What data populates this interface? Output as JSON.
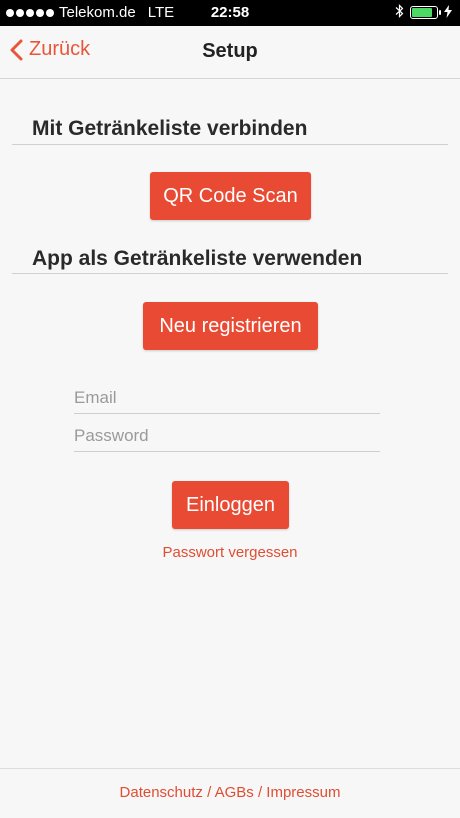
{
  "status_bar": {
    "carrier": "Telekom.de",
    "network": "LTE",
    "time": "22:58",
    "signal_bars": 5,
    "battery_level": 0.85
  },
  "navbar": {
    "back_label": "Zurück",
    "title": "Setup"
  },
  "sections": {
    "connect": {
      "title": "Mit Getränkeliste verbinden",
      "button_label": "QR Code Scan"
    },
    "use_app": {
      "title": "App als Getränkeliste verwenden",
      "register_label": "Neu registrieren"
    }
  },
  "login": {
    "email_placeholder": "Email",
    "password_placeholder": "Password",
    "login_label": "Einloggen",
    "forgot_label": "Passwort vergessen"
  },
  "footer": {
    "privacy": "Datenschutz",
    "terms": "AGBs",
    "imprint": "Impressum",
    "separator": " / "
  },
  "colors": {
    "accent": "#e84a33",
    "battery": "#4cd964"
  }
}
